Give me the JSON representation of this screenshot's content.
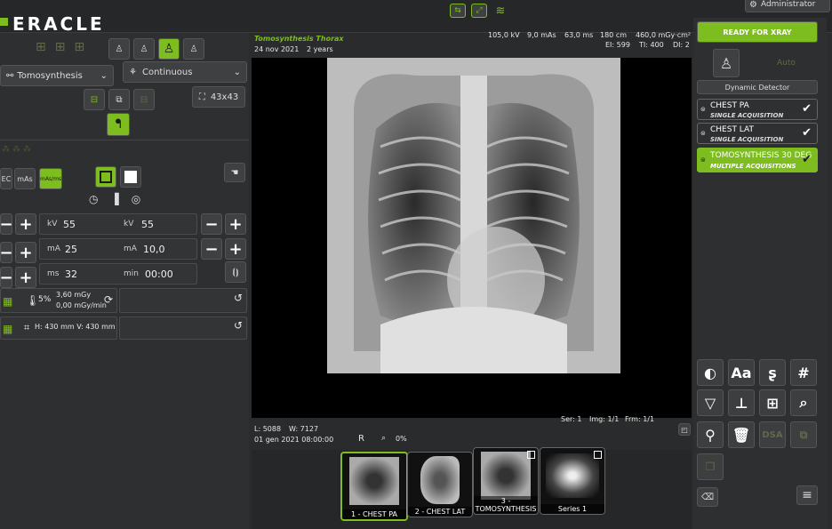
{
  "app": {
    "brand": "ERACLE",
    "user": "Administrator"
  },
  "left": {
    "protocol_dropdown": "Tomosynthesis",
    "mode_dropdown": "Continuous",
    "field_size": "43x43",
    "ec_buttons": [
      "EC",
      "mAs",
      "mAs/ms"
    ],
    "params": [
      {
        "lbl1": "kV",
        "val1": "55",
        "lbl2": "kV",
        "val2": "55"
      },
      {
        "lbl1": "mA",
        "val1": "25",
        "lbl2": "mA",
        "val2": "10,0"
      },
      {
        "lbl1": "ms",
        "val1": "32",
        "lbl2": "min",
        "val2": "00:00"
      }
    ],
    "dose_percent": "5%",
    "dose_mgy": "3,60 mGy",
    "dose_rate": "0,00 mGy/min",
    "dimension_text": "H: 430 mm  V: 430 mm"
  },
  "viewer": {
    "study_title": "Tomosynthesis Thorax",
    "study_date": "24 nov 2021",
    "patient_age": "2 years",
    "tech_kv": "105,0 kV",
    "tech_mas": "9,0 mAs",
    "tech_ms": "63,0 ms",
    "tech_cm": "180 cm",
    "tech_dap": "460,0 mGy·cm²",
    "tech_ei": "EI: 599",
    "tech_ti": "TI: 400",
    "tech_di": "DI: 2",
    "level": "L: 5088",
    "window": "W: 7127",
    "ser": "Ser: 1",
    "img": "Img: 1/1",
    "frm": "Frm: 1/1",
    "datetime": "01 gen 2021 08:00:00",
    "orientation": "R",
    "zoom": "0%"
  },
  "thumbnails": [
    {
      "label": "1 - CHEST PA"
    },
    {
      "label": "2 - CHEST LAT"
    },
    {
      "label": "3 - TOMOSYNTHESIS"
    },
    {
      "label": "Series 1"
    }
  ],
  "right": {
    "status_button": "READY FOR XRAY",
    "auto_label": "Auto",
    "detector": "Dynamic Detector",
    "exams": [
      {
        "name": "CHEST PA",
        "sub": "SINGLE ACQUISITION"
      },
      {
        "name": "CHEST LAT",
        "sub": "SINGLE ACQUISITION"
      },
      {
        "name": "TOMOSYNTHESIS 30 DEG",
        "sub": "MULTIPLE ACQUISITIONS"
      }
    ],
    "tool_text": "Aa",
    "dsa": "DSA"
  },
  "colors": {
    "accent": "#7dbd1f",
    "background": "#2b2c2d"
  }
}
